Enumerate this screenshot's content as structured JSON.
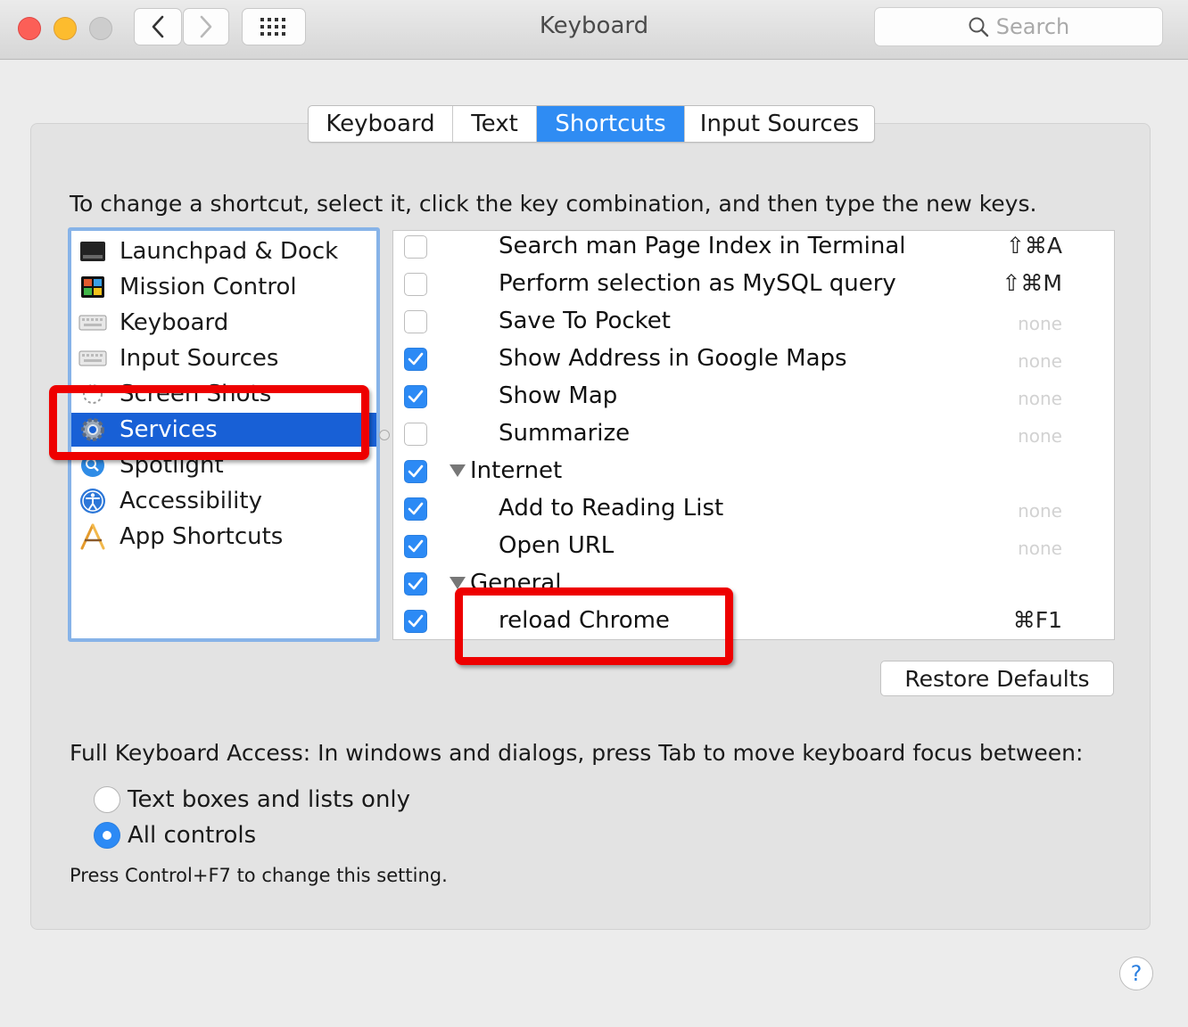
{
  "window": {
    "title": "Keyboard"
  },
  "search": {
    "placeholder": "Search"
  },
  "tabs": [
    {
      "label": "Keyboard"
    },
    {
      "label": "Text"
    },
    {
      "label": "Shortcuts",
      "active": true
    },
    {
      "label": "Input Sources"
    }
  ],
  "instruction": "To change a shortcut, select it, click the key combination, and then type the new keys.",
  "categories": [
    {
      "label": "Launchpad & Dock",
      "icon": "launchpad-icon"
    },
    {
      "label": "Mission Control",
      "icon": "mission-control-icon"
    },
    {
      "label": "Keyboard",
      "icon": "keyboard-icon"
    },
    {
      "label": "Input Sources",
      "icon": "keyboard-icon"
    },
    {
      "label": "Screen Shots",
      "icon": "camera-icon"
    },
    {
      "label": "Services",
      "icon": "gear-icon",
      "selected": true
    },
    {
      "label": "Spotlight",
      "icon": "spotlight-icon"
    },
    {
      "label": "Accessibility",
      "icon": "accessibility-icon"
    },
    {
      "label": "App Shortcuts",
      "icon": "app-shortcuts-icon"
    }
  ],
  "shortcuts": [
    {
      "label": "Search man Page Index in Terminal",
      "checked": false,
      "key": "⇧⌘A"
    },
    {
      "label": "Perform selection as MySQL query",
      "checked": false,
      "key": "⇧⌘M"
    },
    {
      "label": "Save To Pocket",
      "checked": false,
      "key": "none"
    },
    {
      "label": "Show Address in Google Maps",
      "checked": true,
      "key": "none"
    },
    {
      "label": "Show Map",
      "checked": true,
      "key": "none"
    },
    {
      "label": "Summarize",
      "checked": false,
      "key": "none"
    },
    {
      "label": "Internet",
      "checked": true,
      "group": true,
      "key": ""
    },
    {
      "label": "Add to Reading List",
      "checked": true,
      "key": "none"
    },
    {
      "label": "Open URL",
      "checked": true,
      "key": "none"
    },
    {
      "label": "General",
      "checked": true,
      "group": true,
      "key": ""
    },
    {
      "label": "reload Chrome",
      "checked": true,
      "key": "⌘F1"
    }
  ],
  "restore_defaults": "Restore Defaults",
  "full_keyboard_access": {
    "label": "Full Keyboard Access: In windows and dialogs, press Tab to move keyboard focus between:",
    "options": [
      {
        "label": "Text boxes and lists only",
        "selected": false
      },
      {
        "label": "All controls",
        "selected": true
      }
    ],
    "hint": "Press Control+F7 to change this setting."
  },
  "help": "?",
  "colors": {
    "accent": "#2f8cf3",
    "selection": "#1860d6",
    "annotation": "#ee0000"
  }
}
